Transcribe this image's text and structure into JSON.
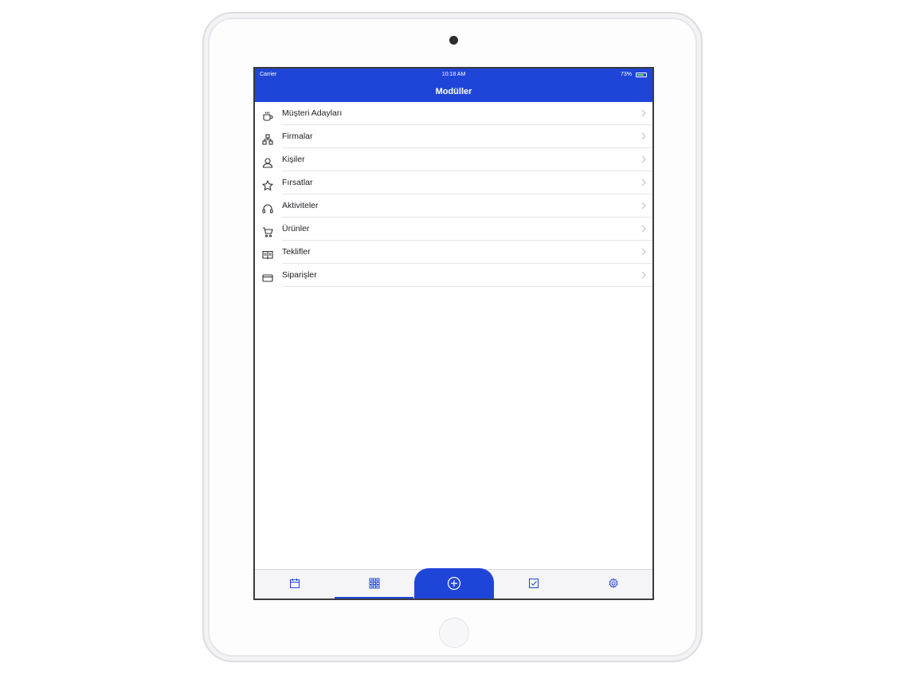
{
  "status_bar": {
    "carrier": "Carrier",
    "time": "10:18 AM",
    "battery": "73%"
  },
  "nav": {
    "title": "Modüller"
  },
  "modules": [
    {
      "label": "Müşteri Adayları",
      "icon": "cup-icon"
    },
    {
      "label": "Firmalar",
      "icon": "org-chart-icon"
    },
    {
      "label": "Kişiler",
      "icon": "contacts-icon"
    },
    {
      "label": "Fırsatlar",
      "icon": "star-icon"
    },
    {
      "label": "Aktiviteler",
      "icon": "headset-icon"
    },
    {
      "label": "Ürünler",
      "icon": "cart-icon"
    },
    {
      "label": "Teklifler",
      "icon": "book-icon"
    },
    {
      "label": "Siparişler",
      "icon": "credit-card-icon"
    }
  ],
  "tab_bar": {
    "tabs": [
      {
        "name": "calendar-icon",
        "active": false
      },
      {
        "name": "grid-icon",
        "active": true
      },
      {
        "name": "add-circle-icon",
        "active": false
      },
      {
        "name": "checkbox-icon",
        "active": false
      },
      {
        "name": "settings-icon",
        "active": false
      }
    ]
  },
  "colors": {
    "accent": "#1f45d8",
    "text": "#1d1d22",
    "separator": "#e4e4e8"
  }
}
